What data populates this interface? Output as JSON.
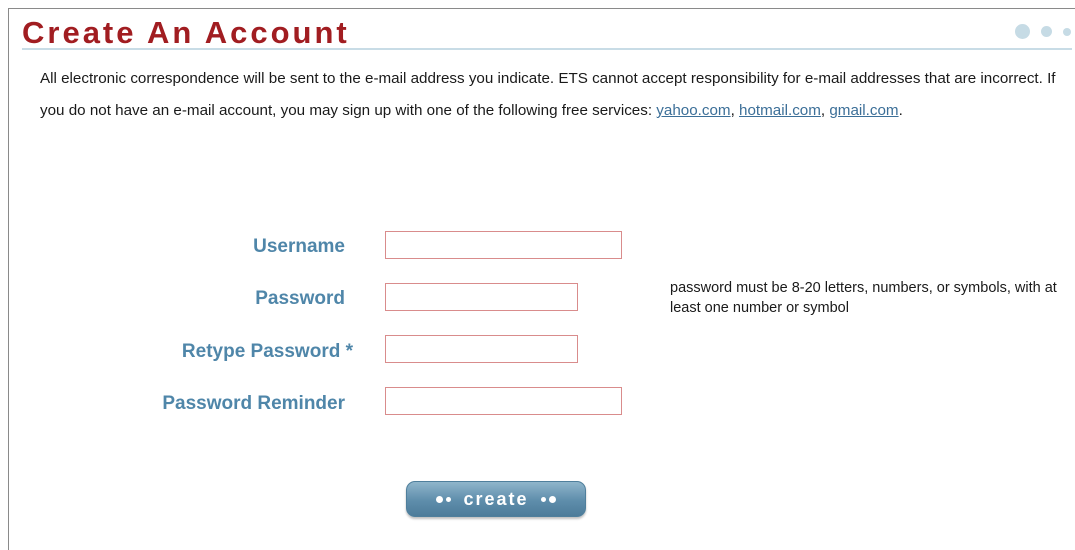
{
  "header": {
    "title": "Create An Account"
  },
  "intro": {
    "text_before": "All electronic correspondence will be sent to the e-mail address you indicate. ETS cannot accept responsibility for e-mail addresses that are incorrect. If you do not have an e-mail account, you may sign up with one of the following free services: ",
    "links": [
      "yahoo.com",
      "hotmail.com",
      "gmail.com"
    ],
    "sep1": ", ",
    "sep2": ", ",
    "end": "."
  },
  "form": {
    "username_label": "Username",
    "password_label": "Password",
    "retype_label": "Retype Password *",
    "reminder_label": "Password Reminder",
    "username_value": "",
    "password_value": "",
    "retype_value": "",
    "reminder_value": "",
    "password_hint": "password must be 8-20 letters, numbers, or symbols, with at least one number or symbol"
  },
  "actions": {
    "create_label": "create"
  },
  "colors": {
    "title": "#a11d21",
    "label": "#4f86a9",
    "link": "#3c6f98",
    "field_border": "#d98c8c",
    "button": "#5e8dab"
  }
}
